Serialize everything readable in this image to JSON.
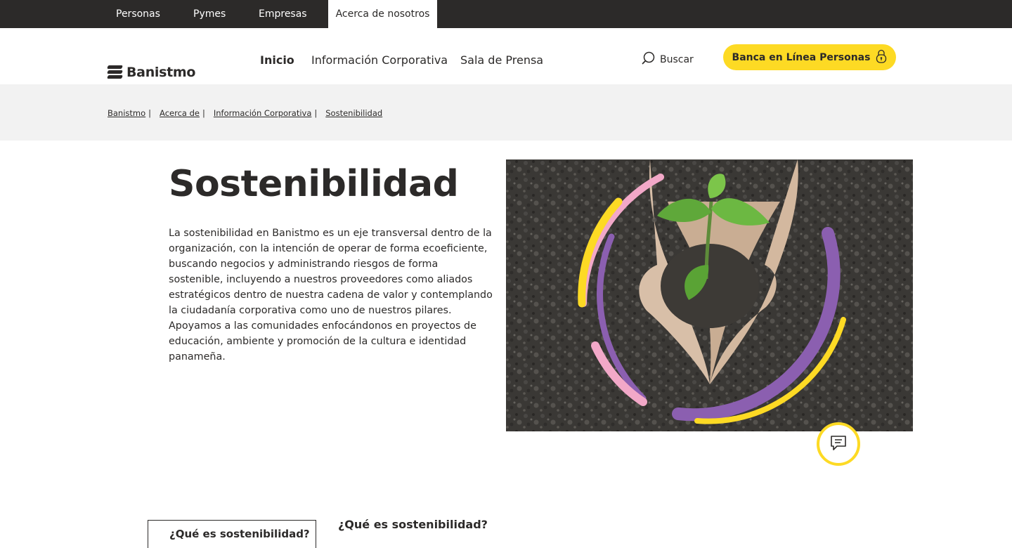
{
  "topbar": {
    "items": [
      {
        "label": "Personas"
      },
      {
        "label": "Pymes"
      },
      {
        "label": "Empresas"
      },
      {
        "label": "Acerca de nosotros",
        "active": true
      }
    ]
  },
  "header": {
    "logo_text": "Banistmo",
    "nav": [
      {
        "label": "Inicio",
        "active": true
      },
      {
        "label": "Información Corporativa"
      },
      {
        "label": "Sala de Prensa"
      }
    ],
    "search_label": "Buscar",
    "search_icon": "search-icon",
    "online_banking_label": "Banca en Línea Personas",
    "online_banking_icon": "lock-icon"
  },
  "breadcrumb": [
    "Banistmo",
    "Acerca de",
    "Información Corporativa",
    "Sostenibilidad"
  ],
  "main": {
    "title": "Sostenibilidad",
    "lead": "La sostenibilidad en Banistmo es un eje transversal dentro de la organización, con la intención de operar de forma ecoeficiente, buscando negocios y administrando riesgos de forma sostenible, incluyendo a nuestros proveedores como aliados estratégicos dentro de nuestra cadena de valor y contemplando la ciudadanía corporativa como uno de nuestros pilares.  Apoyamos a las comunidades enfocándonos en proyectos de educación, ambiente y promoción de la cultura e identidad panameña.",
    "image_subject": "hands-holding-seedling-in-soil"
  },
  "chat_icon": "chat-icon",
  "section": {
    "side_tab": "¿Qué es sostenibilidad?",
    "heading": "¿Qué es sostenibilidad?"
  },
  "colors": {
    "brand_yellow": "#fdda24",
    "dark": "#2c2a29",
    "purple": "#8b5fb0",
    "pink": "#f2a8c8",
    "breadcrumb_bg": "#f2f2f2"
  }
}
